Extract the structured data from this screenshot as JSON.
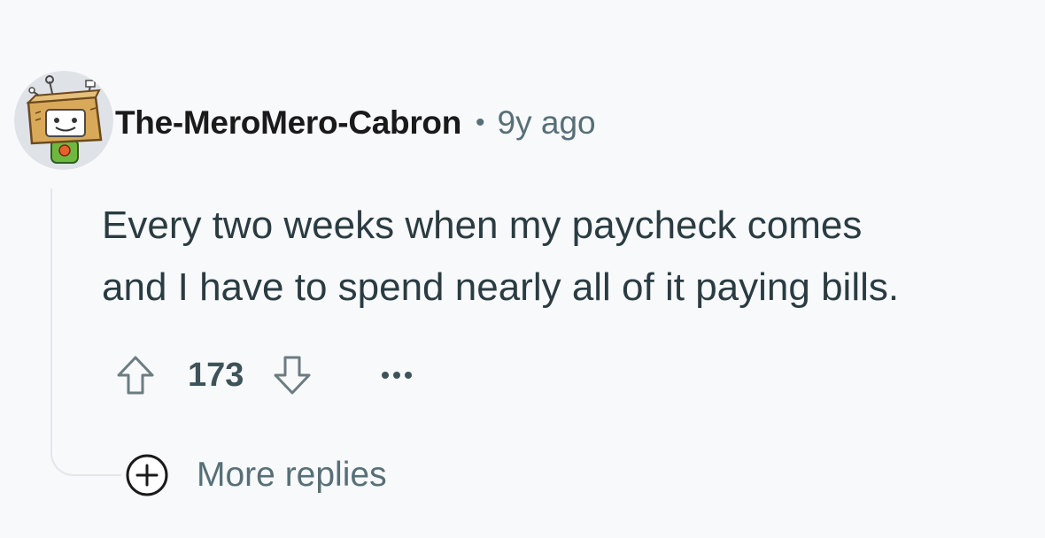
{
  "comment": {
    "author": "The-MeroMero-Cabron",
    "separator": "•",
    "timestamp": "9y ago",
    "body_lines": [
      "Every two weeks when my paycheck comes",
      "and I have to spend nearly all of it paying bills."
    ],
    "score": "173",
    "more_replies_label": "More replies"
  },
  "icons": {
    "avatar": "snoo-box-head-avatar",
    "upvote": "arrow-up-icon",
    "downvote": "arrow-down-icon",
    "overflow": "ellipsis-icon",
    "expand": "plus-circle-icon"
  },
  "colors": {
    "background": "#f8f9fb",
    "username": "#1a1a1b",
    "meta": "#576f76",
    "body": "#2a3c42",
    "score": "#3e5359",
    "thread_line": "#e3e7ec"
  }
}
